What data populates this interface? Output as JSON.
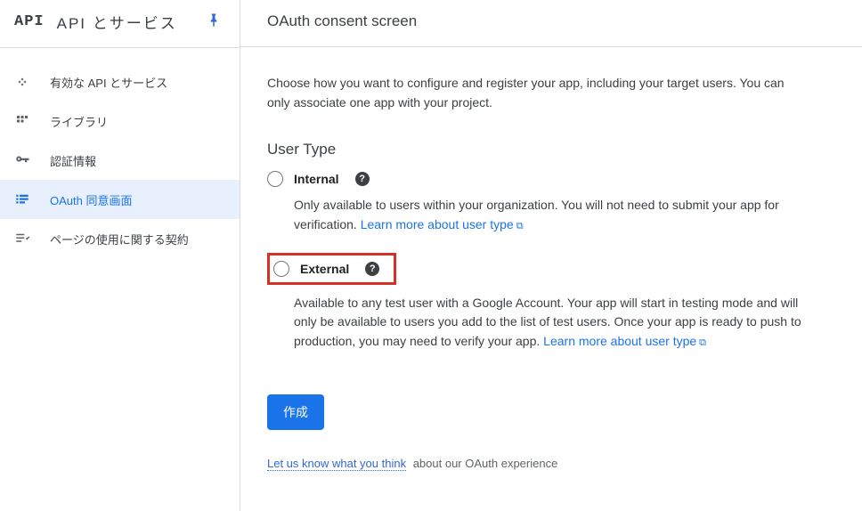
{
  "sidebar": {
    "logo": "API",
    "title": "API とサービス",
    "items": [
      {
        "label": "有効な API とサービス"
      },
      {
        "label": "ライブラリ"
      },
      {
        "label": "認証情報"
      },
      {
        "label": "OAuth 同意画面"
      },
      {
        "label": "ページの使用に関する契約"
      }
    ]
  },
  "header": {
    "title": "OAuth consent screen"
  },
  "intro": "Choose how you want to configure and register your app, including your target users. You can only associate one app with your project.",
  "userType": {
    "title": "User Type",
    "internal": {
      "label": "Internal",
      "desc": "Only available to users within your organization. You will not need to submit your app for verification. ",
      "link": "Learn more about user type"
    },
    "external": {
      "label": "External",
      "desc": "Available to any test user with a Google Account. Your app will start in testing mode and will only be available to users you add to the list of test users. Once your app is ready to push to production, you may need to verify your app. ",
      "link": "Learn more about user type"
    }
  },
  "button": {
    "create": "作成"
  },
  "feedback": {
    "link": "Let us know what you think",
    "rest": " about our OAuth experience"
  }
}
